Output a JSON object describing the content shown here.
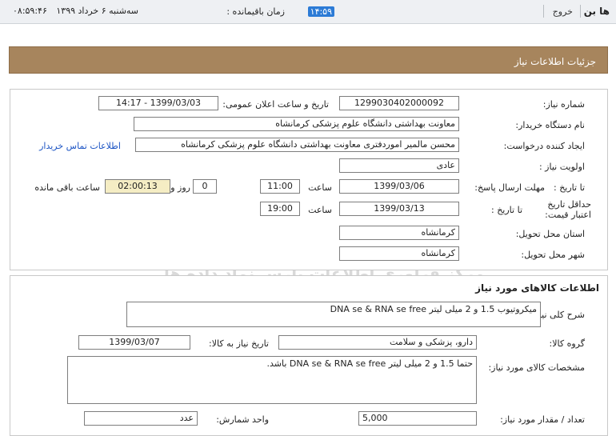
{
  "topbar": {
    "brand": "ها بن",
    "exit": "خروج",
    "remaining_label": "زمان باقیمانده :",
    "remaining_value": "۱۴:۵۹",
    "day_date": "سه‌شنبه ۶ خرداد ۱۳۹۹",
    "time": "۰۸:۵۹:۴۶"
  },
  "header": {
    "title": "جزئیات اطلاعات نیاز"
  },
  "details": {
    "need_number_label": "شماره نیاز:",
    "need_number": "1299030402000092",
    "announce_label": "تاریخ و ساعت اعلان عمومی:",
    "announce_value": "1399/03/03 - 14:17",
    "buyer_label": "نام دستگاه خریدار:",
    "buyer_value": "معاونت بهداشتی دانشگاه علوم پزشکی کرمانشاه",
    "creator_label": "ایجاد کننده درخواست:",
    "creator_value": "محسن مالمیر اموردفتری معاونت بهداشتی دانشگاه علوم پزشکی کرمانشاه",
    "contact_link": "اطلاعات تماس خریدار",
    "priority_label": "اولویت نیاز :",
    "priority_value": "عادی",
    "reply_label": "مهلت ارسال پاسخ:",
    "to_date_label": "تا تاریخ :",
    "reply_date": "1399/03/06",
    "hour_label": "ساعت",
    "reply_time": "11:00",
    "days_value": "0",
    "days_label": "روز و",
    "remain_time": "02:00:13",
    "remain_label": "ساعت باقی مانده",
    "validity_label": "حداقل تاریخ اعتبار قیمت:",
    "validity_to_label": "تا تاریخ :",
    "validity_date": "1399/03/13",
    "validity_hour_label": "ساعت",
    "validity_time": "19:00",
    "province_label": "استان محل تحویل:",
    "province_value": "کرمانشاه",
    "city_label": "شهر محل تحویل:",
    "city_value": "کرمانشاه"
  },
  "goods": {
    "section_title": "اطلاعات کالاهای مورد نیاز",
    "summary_label": "شرح کلی نیاز:",
    "summary_value": "میکروتیوب 1.5 و 2 میلی لیتر DNA se & RNA se free",
    "group_label": "گروه کالا:",
    "group_value": "دارو، پزشکی و سلامت",
    "need_date_label": "تاریخ نیاز به کالا:",
    "need_date_value": "1399/03/07",
    "spec_label": "مشخصات کالای مورد نیاز:",
    "spec_value": "حتما 1.5 و 2 میلی لیتر DNA se & RNA se free باشد.",
    "qty_label": "تعداد / مقدار مورد نیاز:",
    "qty_value": "5,000",
    "unit_label": "واحد شمارش:",
    "unit_value": "عدد"
  },
  "watermark": {
    "line1": "ParsNamadData",
    "line2": "مرکز فراوری اطلاعات پارس نماد داده ها",
    "line3": "سامانه جامع اطلاع رسانی مناقصه ومزایده",
    "line4": "۰۲۱-۸۸۳۴۹۶۷۰"
  }
}
